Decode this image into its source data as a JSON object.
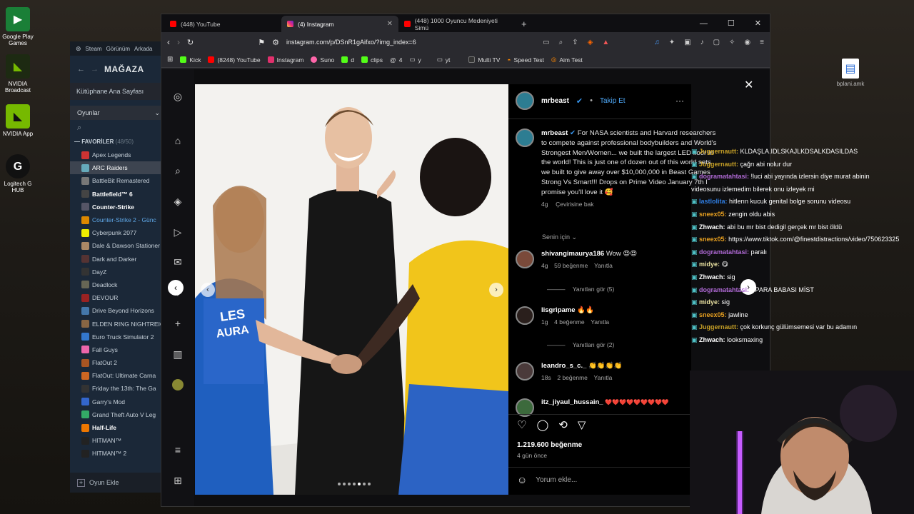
{
  "desktop": {
    "icons": [
      {
        "label": "Google Play Games"
      },
      {
        "label": "NVIDIA Broadcast"
      },
      {
        "label": "NVIDIA App"
      },
      {
        "label": "Logitech G HUB"
      },
      {
        "label": "bplani.amk"
      }
    ]
  },
  "steam": {
    "menu": [
      "Steam",
      "Görünüm",
      "Arkada"
    ],
    "store_label": "MAĞAZA",
    "library_home": "Kütüphane Ana Sayfası",
    "filter_label": "Oyunlar",
    "favorites_label": "FAVORİLER",
    "favorites_count": "(48/50)",
    "games": [
      {
        "name": "Apex Legends",
        "color": "#c33"
      },
      {
        "name": "ARC Raiders",
        "color": "#6ab"
      },
      {
        "name": "BattleBit Remastered",
        "color": "#777"
      },
      {
        "name": "Battlefield™ 6",
        "color": "#444"
      },
      {
        "name": "Counter-Strike",
        "color": "#556"
      },
      {
        "name": "Counter-Strike 2 - Günc",
        "color": "#d80"
      },
      {
        "name": "Cyberpunk 2077",
        "color": "#ee0"
      },
      {
        "name": "Dale & Dawson Stationer",
        "color": "#a86"
      },
      {
        "name": "Dark and Darker",
        "color": "#533"
      },
      {
        "name": "DayZ",
        "color": "#333"
      },
      {
        "name": "Deadlock",
        "color": "#665"
      },
      {
        "name": "DEVOUR",
        "color": "#922"
      },
      {
        "name": "Drive Beyond Horizons",
        "color": "#47a"
      },
      {
        "name": "ELDEN RING NIGHTREIGN",
        "color": "#864"
      },
      {
        "name": "Euro Truck Simulator 2",
        "color": "#37c"
      },
      {
        "name": "Fall Guys",
        "color": "#e6a"
      },
      {
        "name": "FlatOut 2",
        "color": "#a52"
      },
      {
        "name": "FlatOut: Ultimate Carna",
        "color": "#c62"
      },
      {
        "name": "Friday the 13th: The Ga",
        "color": "#333"
      },
      {
        "name": "Garry's Mod",
        "color": "#36c"
      },
      {
        "name": "Grand Theft Auto V Leg",
        "color": "#3a6"
      },
      {
        "name": "Half-Life",
        "color": "#e70"
      },
      {
        "name": "HITMAN™",
        "color": "#222"
      },
      {
        "name": "HITMAN™ 2",
        "color": "#222"
      }
    ],
    "add_game": "Oyun Ekle"
  },
  "browser": {
    "tabs": [
      {
        "title": "(448) YouTube"
      },
      {
        "title": "(4) Instagram"
      },
      {
        "title": "(448) 1000 Oyuncu Medeniyeti Simü"
      }
    ],
    "url": "instagram.com/p/DSnR1gAifxo/?img_index=6",
    "bookmarks": [
      "Kick",
      "(8248) YouTube",
      "Instagram",
      "Suno",
      "d",
      "clips",
      "4",
      "y",
      "yt",
      "Multi TV",
      "Speed Test",
      "Aim Test"
    ]
  },
  "post": {
    "author": "mrbeast",
    "follow_label": "Takip Et",
    "caption": "For NASA scientists and Harvard researchers to compete against professional bodybuilders and World's Strongest Men/Women... we built the largest LED floor in the world! This is just one of dozen out of this world sets we built to give away over $10,000,000 in Beast Games Strong Vs Smart!!! Drops on Prime Video January 7th I promise you'll love it 🥰",
    "caption_age": "4g",
    "translate_label": "Çevirisine bak",
    "for_you_label": "Senin için",
    "comments": [
      {
        "user": "shivangimaurya186",
        "text": "Wow 😍😍",
        "age": "4g",
        "likes": "59 beğenme",
        "reply": "Yanıtla",
        "replies": "Yanıtları gör (5)"
      },
      {
        "user": "lisgripame",
        "text": "🔥🔥",
        "age": "1g",
        "likes": "4 beğenme",
        "reply": "Yanıtla",
        "replies": "Yanıtları gör (2)"
      },
      {
        "user": "leandro_s_c._",
        "text": "👏👏👏👏",
        "age": "18s",
        "likes": "2 beğenme",
        "reply": "Yanıtla",
        "replies": ""
      },
      {
        "user": "itz_jiyaul_hussain_",
        "text": "❤️❤️❤️❤️❤️❤️❤️❤️❤️",
        "age": "",
        "likes": "",
        "reply": "",
        "replies": ""
      }
    ],
    "like_count": "1.219.600 beğenme",
    "posted_ago": "4 gün önce",
    "comment_placeholder": "Yorum ekle..."
  },
  "chat": {
    "messages": [
      {
        "user": "Juggernautt:",
        "text": "KLDAŞLA.IDLSKAJLKDSALKDASILDAS",
        "color": "#c9a227"
      },
      {
        "user": "Juggernautt:",
        "text": "çağrı abi nolur dur",
        "color": "#c9a227"
      },
      {
        "user": "dogramatahtasi:",
        "text": "!luci abi yayında izlersin diye murat abinin",
        "color": "#b06ad6"
      },
      {
        "user": "",
        "text": "videosunu izlemedim bilerek onu izleyek mi",
        "color": "#fff"
      },
      {
        "user": "lastlolita:",
        "text": "hitlerın kucuk genital bolge sorunu videosu",
        "color": "#2f7de1"
      },
      {
        "user": "sneex05:",
        "text": "zengin oldu abis",
        "color": "#e8a020"
      },
      {
        "user": "Zhwach:",
        "text": "abi bu mr bist dedigil gerçek mr bist öldü",
        "color": "#fff"
      },
      {
        "user": "",
        "text": "",
        "color": "#fff"
      },
      {
        "user": "sneex05:",
        "text": "https://www.tiktok.com/@finestdistractions/video/750623325",
        "color": "#e8a020"
      },
      {
        "user": "",
        "text": "",
        "color": "#fff"
      },
      {
        "user": "dogramatahtasi:",
        "text": "paralı",
        "color": "#b06ad6"
      },
      {
        "user": "midye:",
        "text": "😋",
        "color": "#e8e0a0"
      },
      {
        "user": "Zhwach:",
        "text": "sig",
        "color": "#fff"
      },
      {
        "user": "dogramatahtasi:",
        "text": "PPARA BABASI MİST",
        "color": "#b06ad6"
      },
      {
        "user": "midye:",
        "text": "sig",
        "color": "#e8e0a0"
      },
      {
        "user": "sneex05:",
        "text": "jawline",
        "color": "#e8a020"
      },
      {
        "user": "Juggernautt:",
        "text": "çok korkunç gülümsemesi var bu adamın",
        "color": "#c9a227"
      },
      {
        "user": "Zhwach:",
        "text": "looksmaxing",
        "color": "#fff"
      }
    ]
  }
}
